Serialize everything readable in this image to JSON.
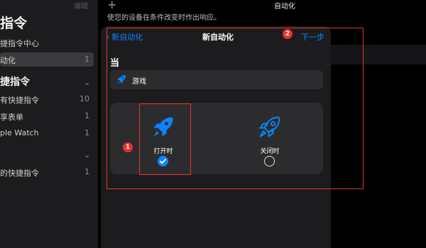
{
  "sidebar": {
    "edit_label": "编辑",
    "title": "指令",
    "rows": [
      {
        "label": "捷指令中心",
        "count": ""
      },
      {
        "label": "动化",
        "count": "1"
      }
    ],
    "section_label": "捷指令",
    "items": [
      {
        "label": "有快捷指令",
        "count": "10"
      },
      {
        "label": "享表单",
        "count": "1"
      },
      {
        "label": "ple Watch",
        "count": "1"
      },
      {
        "label": "",
        "count": ""
      },
      {
        "label": "的快捷指令",
        "count": "1"
      }
    ]
  },
  "main": {
    "title": "自动化",
    "description": "使您的设备在条件改变时作出响应。"
  },
  "sheet": {
    "back_label": "新自动化",
    "title": "新自动化",
    "next_label": "下一步",
    "when_label": "当",
    "trigger_label": "游戏",
    "options": [
      {
        "label": "打开时",
        "selected": true
      },
      {
        "label": "关闭时",
        "selected": false
      }
    ]
  },
  "annotations": [
    "1",
    "2"
  ],
  "colors": {
    "accent": "#0a84ff",
    "annotation": "#e8322b",
    "panel": "#1c1c1e",
    "card": "#2c2c2e"
  },
  "icons": [
    "plus-icon",
    "back-chevron-icon",
    "rocket-icon",
    "checkmark-icon",
    "empty-circle-icon",
    "chevron-down-icon"
  ]
}
